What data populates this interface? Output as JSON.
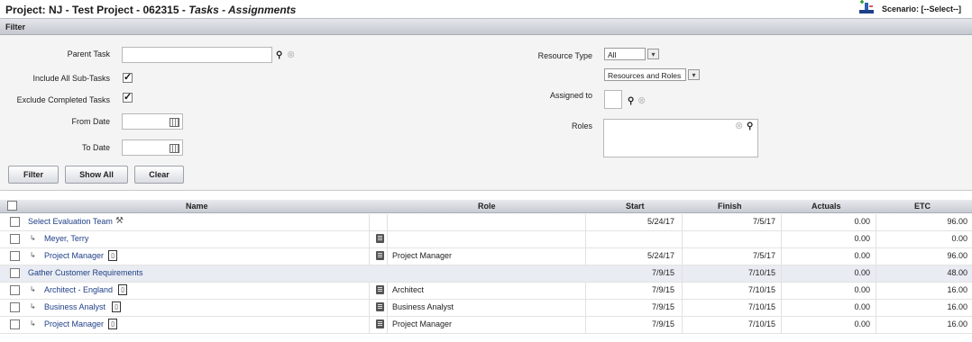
{
  "title": {
    "prefix": "Project: NJ - Test Project - 062315 - ",
    "suffix": "Tasks - Assignments"
  },
  "scenario": {
    "label": "Scenario: [--Select--]",
    "icon": "scenario-icon"
  },
  "filter": {
    "header": "Filter",
    "parent_task_label": "Parent Task",
    "parent_task_value": "",
    "include_subtasks_label": "Include All Sub-Tasks",
    "include_subtasks_checked": true,
    "exclude_completed_label": "Exclude Completed Tasks",
    "exclude_completed_checked": true,
    "from_date_label": "From Date",
    "to_date_label": "To Date",
    "resource_type_label": "Resource Type",
    "resource_type_value": "All",
    "resources_roles_value": "Resources and Roles",
    "assigned_to_label": "Assigned to",
    "roles_label": "Roles",
    "buttons": {
      "filter": "Filter",
      "show_all": "Show All",
      "clear": "Clear"
    }
  },
  "grid": {
    "columns": {
      "name": "Name",
      "role": "Role",
      "start": "Start",
      "finish": "Finish",
      "actuals": "Actuals",
      "etc": "ETC"
    },
    "rows": [
      {
        "name": "Select Evaluation Team",
        "role": "",
        "start": "5/24/17",
        "finish": "7/5/17",
        "actuals": "0.00",
        "etc": "96.00"
      },
      {
        "name": "Meyer, Terry",
        "role": "",
        "start": "",
        "finish": "",
        "actuals": "0.00",
        "etc": "0.00"
      },
      {
        "name": "Project Manager",
        "role": "Project Manager",
        "start": "5/24/17",
        "finish": "7/5/17",
        "actuals": "0.00",
        "etc": "96.00"
      },
      {
        "name": "Gather Customer Requirements",
        "role": "",
        "start": "7/9/15",
        "finish": "7/10/15",
        "actuals": "0.00",
        "etc": "48.00"
      },
      {
        "name": "Architect - England",
        "role": "Architect",
        "start": "7/9/15",
        "finish": "7/10/15",
        "actuals": "0.00",
        "etc": "16.00"
      },
      {
        "name": "Business Analyst",
        "role": "Business Analyst",
        "start": "7/9/15",
        "finish": "7/10/15",
        "actuals": "0.00",
        "etc": "16.00"
      },
      {
        "name": "Project Manager",
        "role": "Project Manager",
        "start": "7/9/15",
        "finish": "7/10/15",
        "actuals": "0.00",
        "etc": "16.00"
      }
    ]
  }
}
